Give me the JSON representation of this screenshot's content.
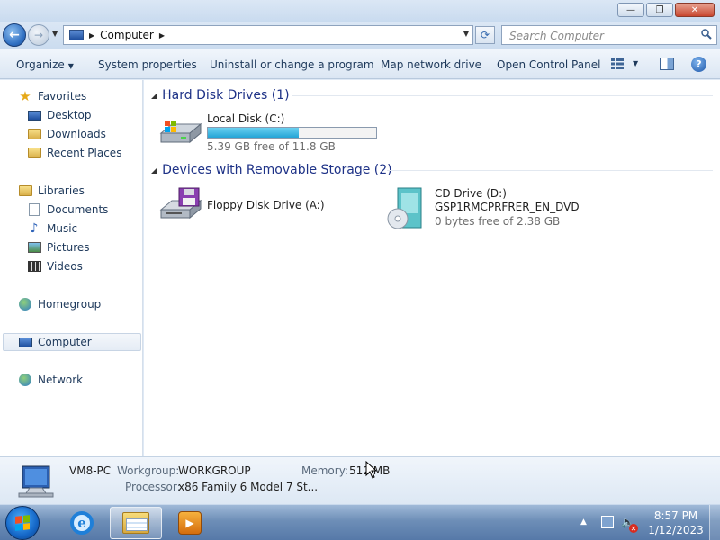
{
  "window": {
    "minimize": "—",
    "maximize": "❐",
    "close": "✕"
  },
  "nav": {
    "address_path": "Computer",
    "search_placeholder": "Search Computer"
  },
  "toolbar": {
    "organize": "Organize",
    "system_properties": "System properties",
    "uninstall": "Uninstall or change a program",
    "map_network_drive": "Map network drive",
    "open_control_panel": "Open Control Panel",
    "help": "?"
  },
  "sidebar": {
    "favorites": "Favorites",
    "desktop": "Desktop",
    "downloads": "Downloads",
    "recent_places": "Recent Places",
    "libraries": "Libraries",
    "documents": "Documents",
    "music": "Music",
    "pictures": "Pictures",
    "videos": "Videos",
    "homegroup": "Homegroup",
    "computer": "Computer",
    "network": "Network"
  },
  "groups": {
    "hard_disk": "Hard Disk Drives (1)",
    "removable": "Devices with Removable Storage (2)"
  },
  "drives": {
    "local_disk": {
      "name": "Local Disk (C:)",
      "free": "5.39 GB free of 11.8 GB",
      "used_fraction": 0.54
    },
    "floppy": {
      "name": "Floppy Disk Drive (A:)"
    },
    "cd": {
      "name": "CD Drive (D:)",
      "label": "GSP1RMCPRFRER_EN_DVD",
      "free": "0 bytes free of 2.38 GB"
    }
  },
  "details": {
    "computer_name": "VM8-PC",
    "workgroup_label": "Workgroup:",
    "workgroup_value": "WORKGROUP",
    "memory_label": "Memory:",
    "memory_value": "512 MB",
    "processor_label": "Processor:",
    "processor_value": "x86 Family 6 Model 7 St..."
  },
  "taskbar": {
    "time": "8:57 PM",
    "date": "1/12/2023",
    "ie_glyph": "e"
  },
  "colors": {
    "accent": "#2fa6d8",
    "group_header": "#1e3287",
    "link": "#1e395b"
  }
}
